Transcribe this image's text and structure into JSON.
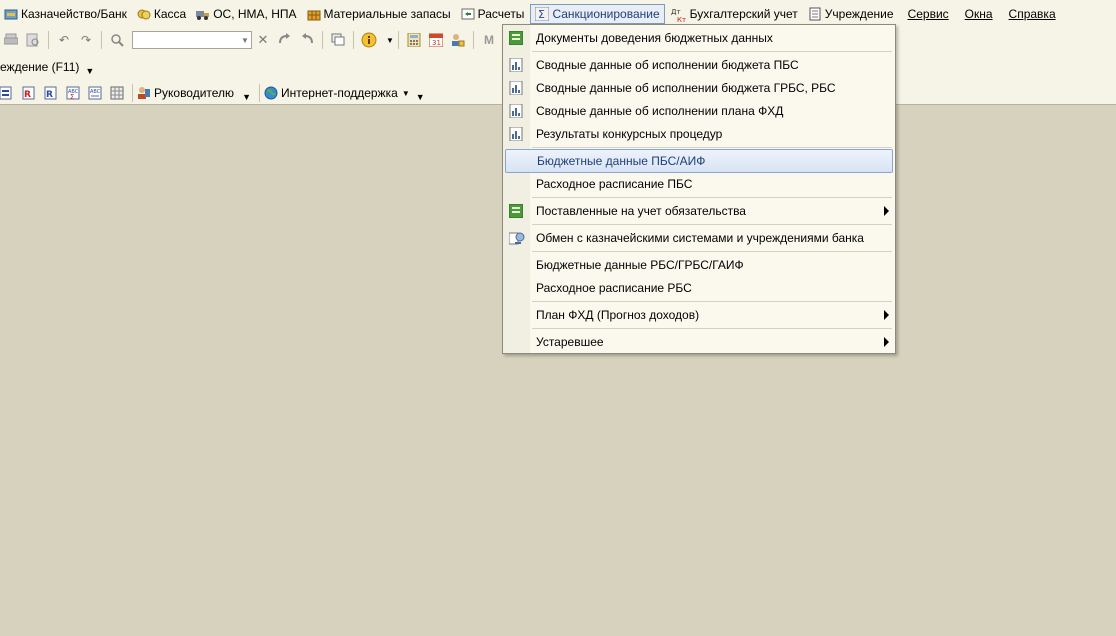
{
  "menubar": {
    "items": [
      {
        "label": "Казначейство/Банк",
        "icon": "bank-icon"
      },
      {
        "label": "Касса",
        "icon": "cashbox-icon"
      },
      {
        "label": "ОС, НМА, НПА",
        "icon": "truck-icon"
      },
      {
        "label": "Материальные запасы",
        "icon": "inventory-icon"
      },
      {
        "label": "Расчеты",
        "icon": "settlements-icon"
      },
      {
        "label": "Санкционирование",
        "icon": "sigma-icon"
      },
      {
        "label": "Бухгалтерский учет",
        "icon": "dt-kt-icon",
        "icon_text_dt": "Дт",
        "icon_text_kt": "Кт"
      },
      {
        "label": "Учреждение",
        "icon": "document-icon"
      },
      {
        "label": "Сервис"
      },
      {
        "label": "Окна"
      },
      {
        "label": "Справка"
      }
    ]
  },
  "toolbar2": {
    "label": "еждение (F11)"
  },
  "toolbar3": {
    "manager_label": "Руководителю",
    "internet_label": "Интернет-поддержка"
  },
  "dropdown": {
    "items": [
      {
        "label": "Документы доведения бюджетных данных",
        "icon": "green-doc-icon"
      },
      {
        "label": "Сводные данные об исполнении бюджета ПБС",
        "icon": "report-icon"
      },
      {
        "label": "Сводные данные об исполнении бюджета ГРБС, РБС",
        "icon": "report-icon"
      },
      {
        "label": "Сводные данные об исполнении плана ФХД",
        "icon": "report-icon"
      },
      {
        "label": "Результаты конкурсных процедур",
        "icon": "report-icon"
      },
      {
        "label": "Бюджетные данные ПБС/АИФ",
        "highlighted": true
      },
      {
        "label": "Расходное расписание ПБС"
      },
      {
        "label": "Поставленные на учет обязательства",
        "icon": "green-doc-icon",
        "submenu": true
      },
      {
        "label": "Обмен с казначейскими системами и учреждениями банка",
        "icon": "exchange-icon"
      },
      {
        "label": "Бюджетные данные РБС/ГРБС/ГАИФ"
      },
      {
        "label": "Расходное расписание РБС"
      },
      {
        "label": "План ФХД (Прогноз доходов)",
        "submenu": true
      },
      {
        "label": "Устаревшее",
        "submenu": true
      }
    ]
  },
  "colors": {
    "background": "#d6d2bd",
    "menu_background": "#fbf9ee",
    "highlight": "#d7e3f4",
    "highlight_text": "#1f3f7a"
  }
}
